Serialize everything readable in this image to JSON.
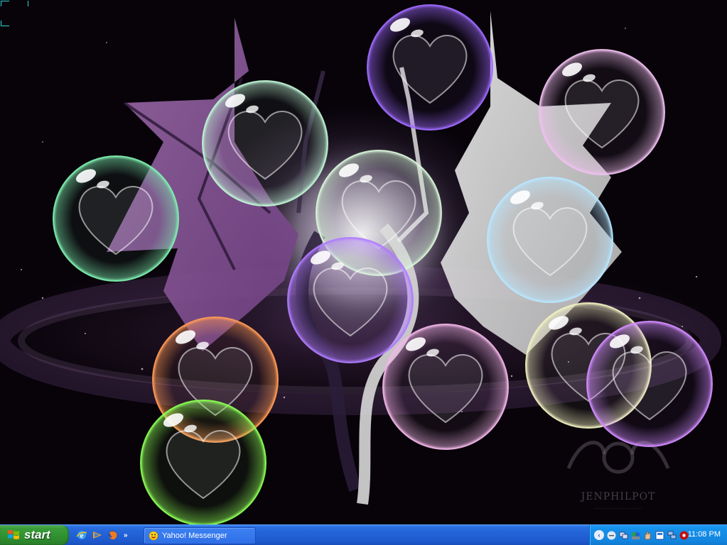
{
  "desktop": {
    "wallpaper": {
      "watermark": "JENPHILPOT",
      "watermark_sub": "...................................",
      "bubbles": [
        {
          "name": "bubble-green-left",
          "color": "#7ff0b0"
        },
        {
          "name": "bubble-mint-top",
          "color": "#bff5d5"
        },
        {
          "name": "bubble-purple-top",
          "color": "#a06bff"
        },
        {
          "name": "bubble-pink-topright",
          "color": "#f0c0f0"
        },
        {
          "name": "bubble-center-white",
          "color": "#d8f5d8"
        },
        {
          "name": "bubble-lightblue-right",
          "color": "#b8e6ff"
        },
        {
          "name": "bubble-violet-center",
          "color": "#b07cff"
        },
        {
          "name": "bubble-orange",
          "color": "#ff9a55"
        },
        {
          "name": "bubble-pink-center",
          "color": "#f2b6e8"
        },
        {
          "name": "bubble-cream-right",
          "color": "#f0f0c0"
        },
        {
          "name": "bubble-purple-right",
          "color": "#d28cff"
        },
        {
          "name": "bubble-green-bottom",
          "color": "#8cff55"
        }
      ]
    }
  },
  "taskbar": {
    "start_label": "start",
    "quick_launch": [
      {
        "icon": "internet-explorer-icon"
      },
      {
        "icon": "windows-media-player-icon"
      },
      {
        "icon": "firefox-icon"
      }
    ],
    "tasks": [
      {
        "label": "Yahoo! Messenger",
        "icon": "yahoo-messenger-icon"
      }
    ],
    "tray_icons": [
      "volume-icon",
      "network-icon",
      "messenger-tray-icon",
      "hand-icon",
      "display-icon",
      "network-connections-icon",
      "media-icon"
    ],
    "clock": "11:08 PM"
  }
}
